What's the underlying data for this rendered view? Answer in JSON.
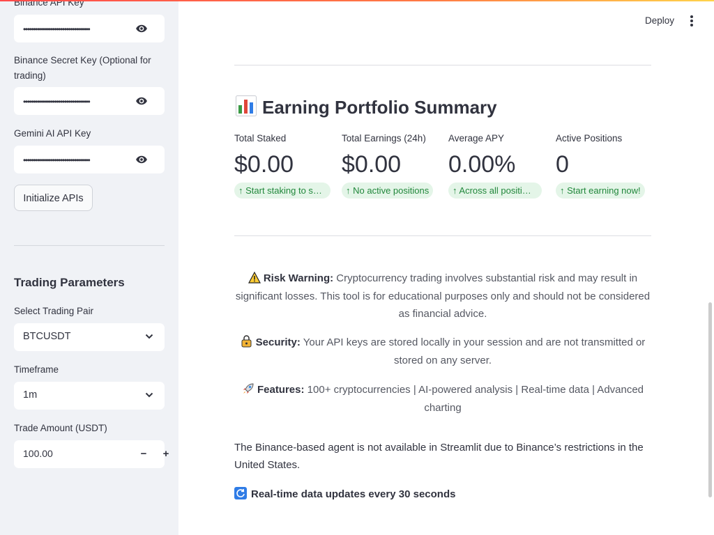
{
  "sidebar": {
    "binance_api_label": "Binance API Key",
    "binance_api_value": "••••••••••••••••••••••••••••••••••",
    "binance_secret_label": "Binance Secret Key (Optional for trading)",
    "binance_secret_value": "••••••••••••••••••••••••••••••••••",
    "gemini_label": "Gemini AI API Key",
    "gemini_value": "••••••••••••••••••••••••••••••••••",
    "initialize_button": "Initialize APIs",
    "trading_heading": "Trading Parameters",
    "pair_label": "Select Trading Pair",
    "pair_value": "BTCUSDT",
    "timeframe_label": "Timeframe",
    "timeframe_value": "1m",
    "amount_label": "Trade Amount (USDT)",
    "amount_value": "100.00",
    "minus_label": "−",
    "plus_label": "+"
  },
  "header": {
    "deploy_label": "Deploy"
  },
  "summary": {
    "title": "Earning Portfolio Summary",
    "metrics": [
      {
        "label": "Total Staked",
        "value": "$0.00",
        "delta": "↑ Start staking to s…"
      },
      {
        "label": "Total Earnings (24h)",
        "value": "$0.00",
        "delta": "↑ No active positions"
      },
      {
        "label": "Average APY",
        "value": "0.00%",
        "delta": "↑ Across all positi…"
      },
      {
        "label": "Active Positions",
        "value": "0",
        "delta": "↑ Start earning now!"
      }
    ]
  },
  "notices": {
    "risk_title": "Risk Warning:",
    "risk_text": " Cryptocurrency trading involves substantial risk and may result in significant losses. This tool is for educational purposes only and should not be considered as financial advice.",
    "security_title": "Security:",
    "security_text": " Your API keys are stored locally in your session and are not transmitted or stored on any server.",
    "features_title": "Features:",
    "features_text": " 100+ cryptocurrencies | AI-powered analysis | Real-time data | Advanced charting",
    "availability": "The Binance-based agent is not available in Streamlit due to Binance’s restrictions in the United States.",
    "realtime": "Real-time data updates every 30 seconds"
  },
  "colors": {
    "accent": "#ff4b4b",
    "delta_bg": "#e4f5e8",
    "delta_text": "#21873b",
    "sidebar_bg": "#f0f2f6"
  }
}
